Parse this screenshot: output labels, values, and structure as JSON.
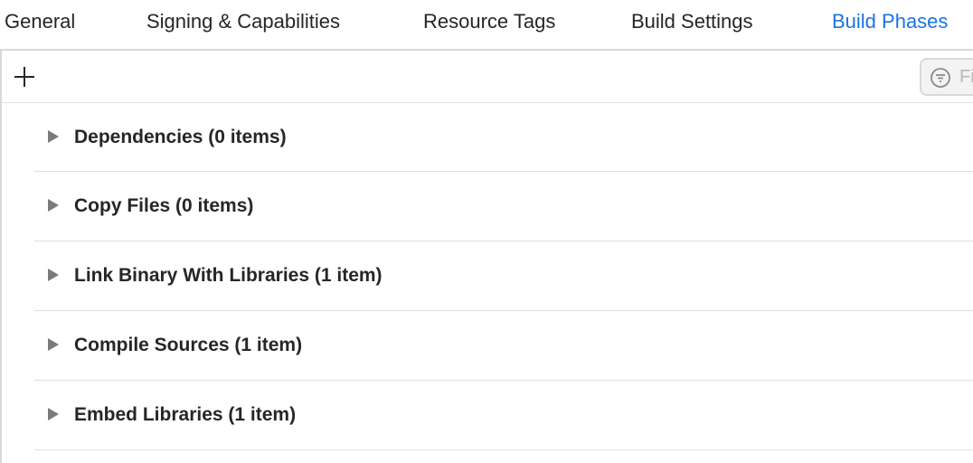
{
  "tabs": [
    {
      "label": "General",
      "active": false
    },
    {
      "label": "Signing & Capabilities",
      "active": false
    },
    {
      "label": "Resource Tags",
      "active": false
    },
    {
      "label": "Build Settings",
      "active": false
    },
    {
      "label": "Build Phases",
      "active": true
    }
  ],
  "toolbar": {
    "add_icon": "plus-icon",
    "filter_icon": "filter-icon",
    "filter_placeholder": "Fi"
  },
  "phases": [
    {
      "label": "Dependencies (0 items)",
      "expanded": false
    },
    {
      "label": "Copy Files (0 items)",
      "expanded": false
    },
    {
      "label": "Link Binary With Libraries (1 item)",
      "expanded": false
    },
    {
      "label": "Compile Sources (1 item)",
      "expanded": false
    },
    {
      "label": "Embed Libraries (1 item)",
      "expanded": false
    }
  ],
  "colors": {
    "accent": "#1a73e8",
    "text": "#262626",
    "separator": "#dedede",
    "triangle": "#7a7a7a"
  }
}
